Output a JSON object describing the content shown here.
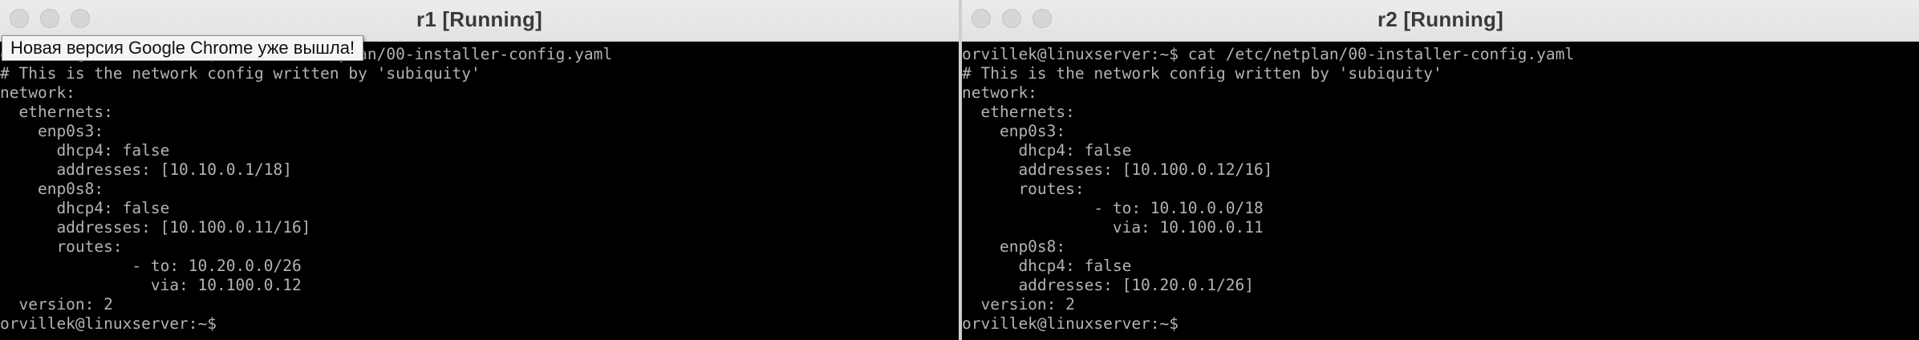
{
  "windows": [
    {
      "title": "r1 [Running]",
      "lines": [
        "orvillek@linuxserver:~$ cat /etc/netplan/00-installer-config.yaml",
        "# This is the network config written by 'subiquity'",
        "network:",
        "  ethernets:",
        "    enp0s3:",
        "      dhcp4: false",
        "      addresses: [10.10.0.1/18]",
        "    enp0s8:",
        "      dhcp4: false",
        "      addresses: [10.100.0.11/16]",
        "      routes:",
        "              - to: 10.20.0.0/26",
        "                via: 10.100.0.12",
        "  version: 2",
        "orvillek@linuxserver:~$"
      ]
    },
    {
      "title": "r2 [Running]",
      "lines": [
        "orvillek@linuxserver:~$ cat /etc/netplan/00-installer-config.yaml",
        "# This is the network config written by 'subiquity'",
        "network:",
        "  ethernets:",
        "    enp0s3:",
        "      dhcp4: false",
        "      addresses: [10.100.0.12/16]",
        "      routes:",
        "              - to: 10.10.0.0/18",
        "                via: 10.100.0.11",
        "    enp0s8:",
        "      dhcp4: false",
        "      addresses: [10.20.0.1/26]",
        "  version: 2",
        "orvillek@linuxserver:~$"
      ]
    }
  ],
  "tooltip": {
    "text": "Новая версия Google Chrome уже вышла!"
  },
  "colors": {
    "terminal_bg": "#000000",
    "terminal_fg": "#b3b3b3",
    "titlebar_bg": "#e6e6e6"
  },
  "icons": {
    "window_controls": [
      "close-icon",
      "minimize-icon",
      "zoom-icon"
    ]
  }
}
